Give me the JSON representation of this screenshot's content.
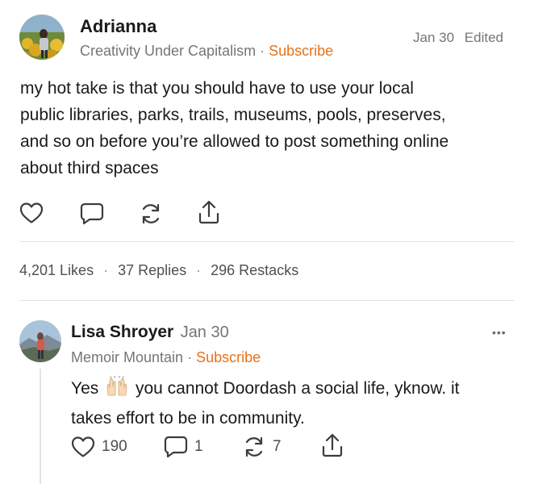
{
  "post": {
    "author": "Adrianna",
    "publication": "Creativity Under Capitalism",
    "separator": "·",
    "subscribe": "Subscribe",
    "date": "Jan 30",
    "edited": "Edited",
    "lines": [
      "my hot take is that you should have to use your local",
      "public libraries, parks, trails, museums, pools, preserves,",
      "and so on before you’re allowed to post something online",
      "about third spaces"
    ],
    "actions": {
      "like_icon": "heart-icon",
      "reply_icon": "comment-icon",
      "restack_icon": "restack-icon",
      "share_icon": "share-icon"
    },
    "stats": {
      "likes": "4,201 Likes",
      "replies": "37 Replies",
      "restacks": "296 Restacks",
      "dot": "·"
    }
  },
  "reply": {
    "author": "Lisa Shroyer",
    "date": "Jan 30",
    "publication": "Memoir Mountain",
    "separator": "·",
    "subscribe": "Subscribe",
    "text_pre": "Yes",
    "emoji": "raised-hands-emoji",
    "text_post": "you cannot Doordash a social life, yknow. it",
    "line2": "takes effort to be in community.",
    "more": "•••",
    "counts": {
      "likes": "190",
      "comments": "1",
      "restacks": "7"
    }
  },
  "colors": {
    "accent": "#e8711a",
    "muted": "#757575",
    "text": "#1a1a1a",
    "divider": "#e3e3e3"
  }
}
